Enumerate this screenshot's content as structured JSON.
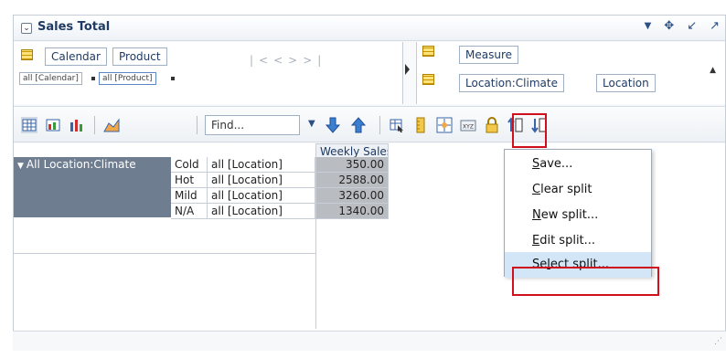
{
  "title": "Sales Total",
  "layout": {
    "row_dims": [
      "Calendar",
      "Product"
    ],
    "row_filters": [
      "all [Calendar]",
      "all [Product]"
    ],
    "col_dims": [
      "Measure"
    ],
    "col_dims2": [
      "Location:Climate",
      "Location"
    ]
  },
  "toolbar": {
    "find_placeholder": "Find..."
  },
  "grid": {
    "col_header": "Weekly Sales",
    "row_header": "All Location:Climate",
    "rows": [
      {
        "climate": "Cold",
        "location": "all [Location]",
        "value": "350.00"
      },
      {
        "climate": "Hot",
        "location": "all [Location]",
        "value": "2588.00"
      },
      {
        "climate": "Mild",
        "location": "all [Location]",
        "value": "3260.00"
      },
      {
        "climate": "N/A",
        "location": "all [Location]",
        "value": "1340.00"
      }
    ]
  },
  "menu": {
    "items": [
      {
        "label": "Save...",
        "u": "S",
        "rest": "ave..."
      },
      {
        "label": "Clear split",
        "u": "C",
        "rest": "lear split"
      },
      {
        "label": "New split...",
        "u": "N",
        "rest": "ew split..."
      },
      {
        "label": "Edit split...",
        "u": "E",
        "rest": "dit split..."
      },
      {
        "label": "Select split...",
        "pre": "Se",
        "u": "l",
        "rest": "ect split..."
      }
    ]
  },
  "colors": {
    "accent": "#1f3b63",
    "highlight_box": "#d0101c",
    "selected_item": "#d3e6f7"
  }
}
